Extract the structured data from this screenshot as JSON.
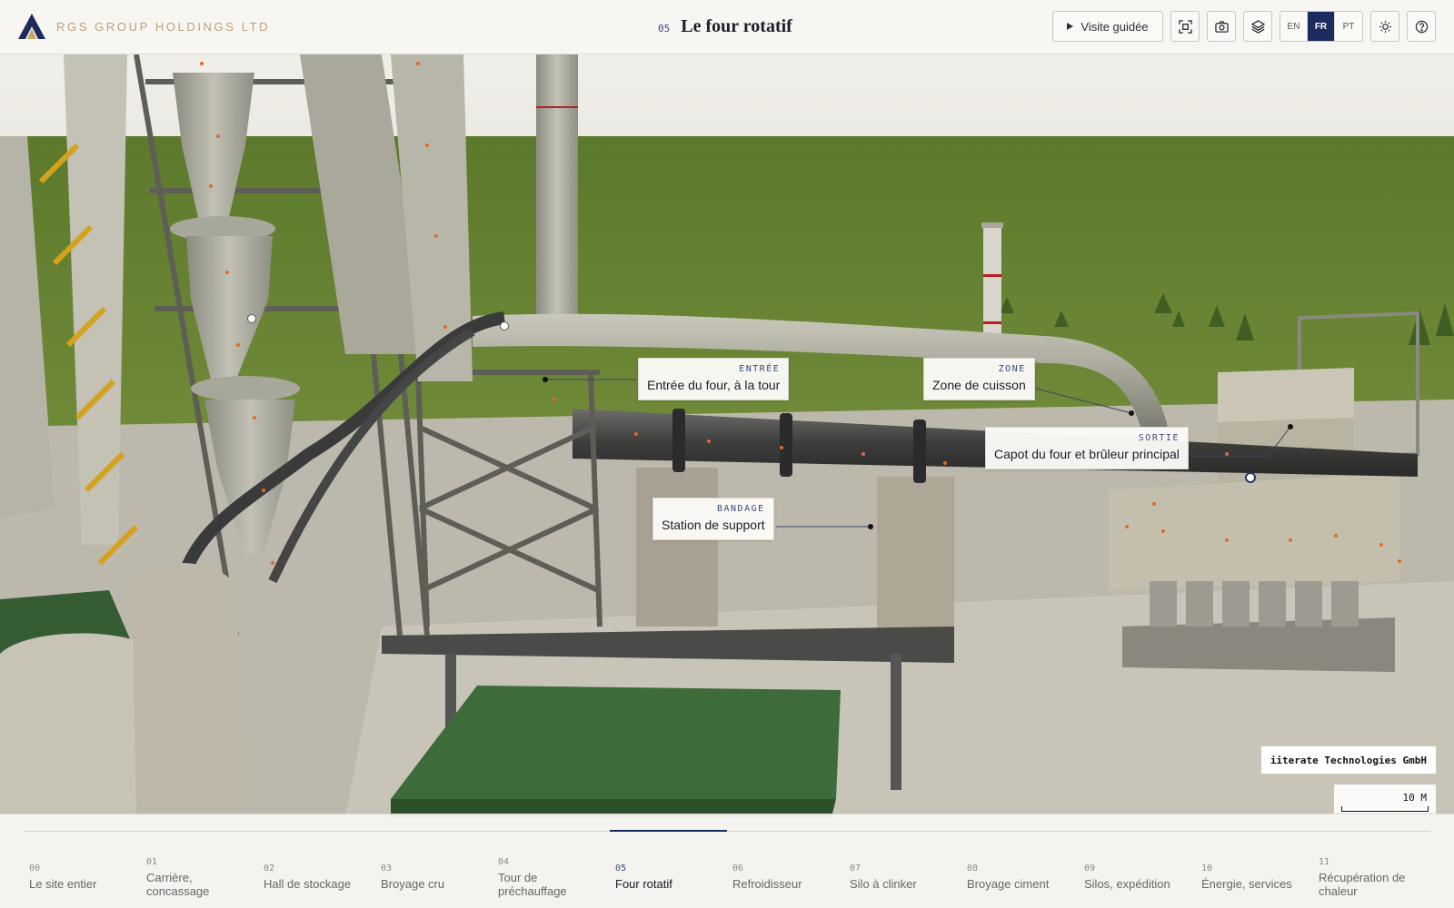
{
  "brand": {
    "name": "RGS GROUP HOLDINGS LTD"
  },
  "header": {
    "section_number": "05",
    "section_title": "Le four rotatif"
  },
  "toolbar": {
    "tour_label": "Visite guidée",
    "icons": [
      "focus-icon",
      "camera-icon",
      "layers-icon",
      "sun-icon",
      "help-icon"
    ],
    "languages": [
      {
        "code": "EN",
        "active": false
      },
      {
        "code": "FR",
        "active": true
      },
      {
        "code": "PT",
        "active": false
      }
    ]
  },
  "callouts": [
    {
      "tag": "ENTRÉE",
      "text": "Entrée du four, à la tour"
    },
    {
      "tag": "ZONE",
      "text": "Zone de cuisson"
    },
    {
      "tag": "SORTIE",
      "text": "Capot du four et brûleur principal"
    },
    {
      "tag": "BANDAGE",
      "text": "Station de support"
    }
  ],
  "attribution": "iiterate Technologies GmbH",
  "scale_label": "10 M",
  "nav": {
    "active_index": 5,
    "items": [
      {
        "num": "00",
        "label": "Le site entier"
      },
      {
        "num": "01",
        "label": "Carrière, concassage"
      },
      {
        "num": "02",
        "label": "Hall de stockage"
      },
      {
        "num": "03",
        "label": "Broyage cru"
      },
      {
        "num": "04",
        "label": "Tour de préchauffage"
      },
      {
        "num": "05",
        "label": "Four rotatif"
      },
      {
        "num": "06",
        "label": "Refroidisseur"
      },
      {
        "num": "07",
        "label": "Silo à clinker"
      },
      {
        "num": "08",
        "label": "Broyage ciment"
      },
      {
        "num": "09",
        "label": "Silos, expédition"
      },
      {
        "num": "10",
        "label": "Énergie, services"
      },
      {
        "num": "11",
        "label": "Récupération de chaleur"
      }
    ]
  },
  "colors": {
    "accent": "#1c2b5e",
    "brand": "#b9a27a",
    "grass": "#5e7a2e",
    "structure": "#9a978c"
  }
}
